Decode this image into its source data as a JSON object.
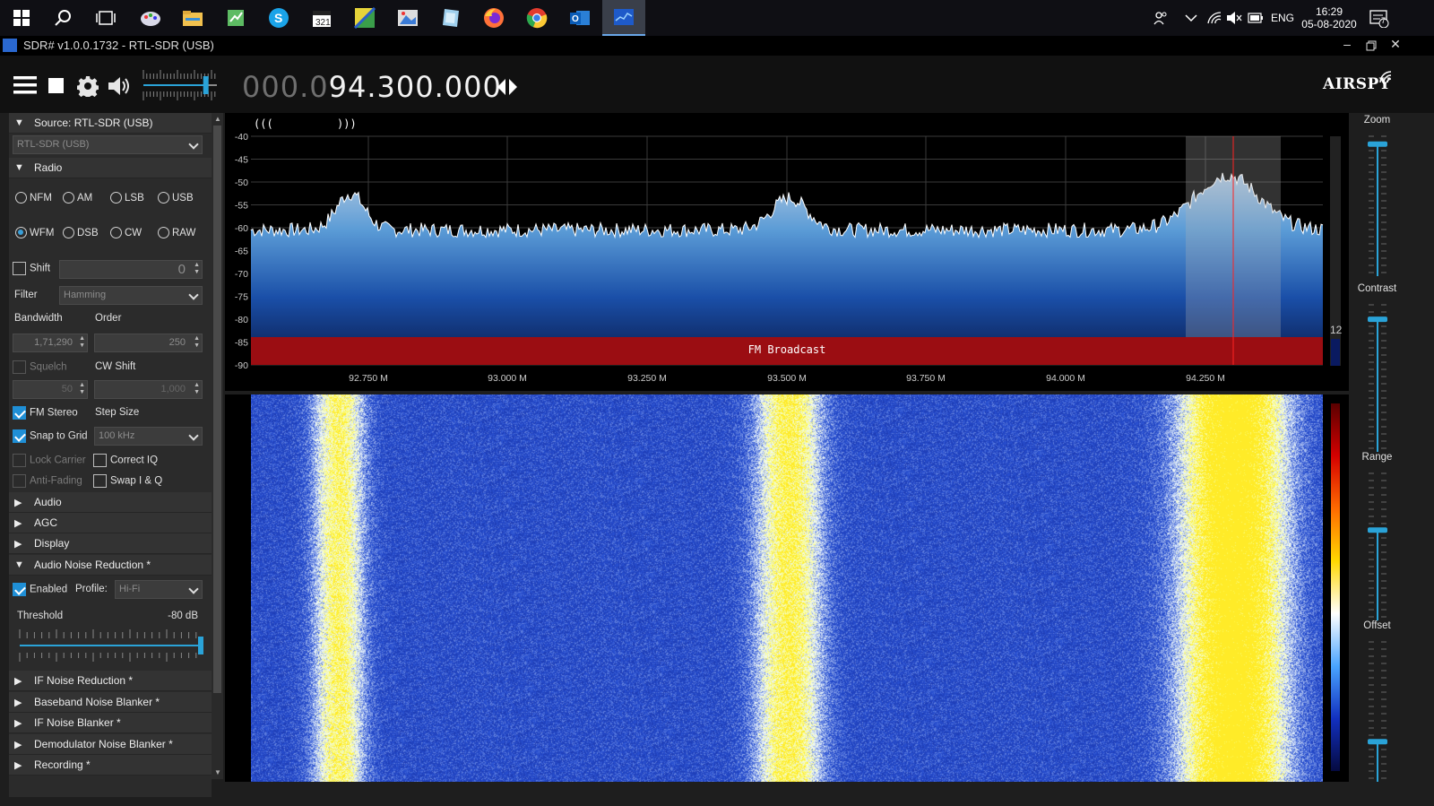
{
  "taskbar": {
    "time": "16:29",
    "date": "05-08-2020",
    "language": "ENG",
    "notification_count": "7",
    "icons": [
      "windows-start-icon",
      "search-icon",
      "task-view-icon",
      "paint-icon",
      "file-explorer-icon",
      "notepad-icon",
      "skype-icon",
      "calendar-icon",
      "maps-icon",
      "photos-icon",
      "notes-icon",
      "firefox-icon",
      "chrome-icon",
      "outlook-icon",
      "sdrsharp-icon"
    ]
  },
  "window": {
    "title": "SDR# v1.0.0.1732 - RTL-SDR (USB)"
  },
  "toolbar": {
    "frequency_dim": "000.0",
    "frequency_bright": "94.300.000",
    "brand": "AIRSPY",
    "volume_level": 0.85
  },
  "left_panel": {
    "source_header": "Source: RTL-SDR (USB)",
    "source_device": "RTL-SDR (USB)",
    "radio_header": "Radio",
    "modes": [
      "NFM",
      "AM",
      "LSB",
      "USB",
      "WFM",
      "DSB",
      "CW",
      "RAW"
    ],
    "selected_mode": "WFM",
    "shift_label": "Shift",
    "shift_value": "0",
    "filter_label": "Filter",
    "filter_value": "Hamming",
    "bandwidth_label": "Bandwidth",
    "order_label": "Order",
    "bandwidth_value": "1,71,290",
    "order_value": "250",
    "squelch_label": "Squelch",
    "cw_shift_label": "CW Shift",
    "squelch_value": "50",
    "cw_shift_value": "1,000",
    "fm_stereo_label": "FM Stereo",
    "step_size_label": "Step Size",
    "snap_label": "Snap to Grid",
    "step_value": "100 kHz",
    "lock_carrier_label": "Lock Carrier",
    "correct_iq_label": "Correct IQ",
    "anti_fading_label": "Anti-Fading",
    "swap_iq_label": "Swap I & Q",
    "audio_header": "Audio",
    "agc_header": "AGC",
    "display_header": "Display",
    "anr_header": "Audio Noise Reduction *",
    "enabled_label": "Enabled",
    "profile_label": "Profile:",
    "profile_value": "Hi-Fi",
    "threshold_label": "Threshold",
    "threshold_value": "-80 dB",
    "if_nr_header": "IF Noise Reduction *",
    "bb_nb_header": "Baseband Noise Blanker *",
    "if_nb_header": "IF Noise Blanker *",
    "demod_nb_header": "Demodulator Noise Blanker *",
    "recording_header": "Recording *"
  },
  "spectrum": {
    "top_left_marker": "(((",
    "top_right_marker": ")))",
    "y_ticks": [
      "-40",
      "-45",
      "-50",
      "-55",
      "-60",
      "-65",
      "-70",
      "-75",
      "-80",
      "-85",
      "-90"
    ],
    "x_ticks": [
      "92.750 M",
      "93.000 M",
      "93.250 M",
      "93.500 M",
      "93.750 M",
      "94.000 M",
      "94.250 M"
    ],
    "band_label": "FM Broadcast",
    "side_value": "12",
    "colors": {
      "band": "#9b0d12",
      "tuned_line": "#ff2222",
      "fill_top": "#5a9bd6",
      "fill_bottom": "#0a1a4a"
    }
  },
  "right_panel": {
    "zoom_label": "Zoom",
    "contrast_label": "Contrast",
    "range_label": "Range",
    "offset_label": "Offset"
  }
}
